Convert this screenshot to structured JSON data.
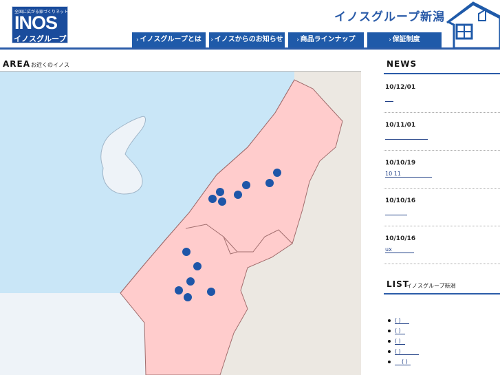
{
  "header": {
    "logo_tagline": "全国に広がる家づくりネットワーク",
    "logo_text": "INOS",
    "logo_sub": "イノスグループ",
    "site_title": "イノスグループ新潟"
  },
  "nav": [
    {
      "label": "イノスグループとは"
    },
    {
      "label": "イノスからのお知らせ"
    },
    {
      "label": "商品ラインナップ"
    },
    {
      "label": "保証制度"
    }
  ],
  "nav_arrow": "›",
  "area": {
    "title": "AREA",
    "subtitle": "お近くのイノス"
  },
  "map_colors": {
    "sea": "#c9e6f7",
    "land": "#ece8e2",
    "niigata": "#ffcccc",
    "border": "#a26e6e",
    "marker": "#1e56a8",
    "island": "#eef3f8"
  },
  "news": {
    "title": "NEWS",
    "items": [
      {
        "date": "10/12/01",
        "link": " "
      },
      {
        "date": "10/11/01",
        "link": " "
      },
      {
        "date": "10/10/19",
        "link": "10 11"
      },
      {
        "date": "10/10/16",
        "link": " "
      },
      {
        "date": "10/10/16",
        "link": "ux"
      }
    ]
  },
  "list": {
    "title": "LIST",
    "subtitle": "イノスグループ新潟",
    "items": [
      {
        "text": "( )"
      },
      {
        "text": "( )"
      },
      {
        "text": "( )"
      },
      {
        "text": "( )"
      },
      {
        "text": "( )"
      }
    ]
  }
}
